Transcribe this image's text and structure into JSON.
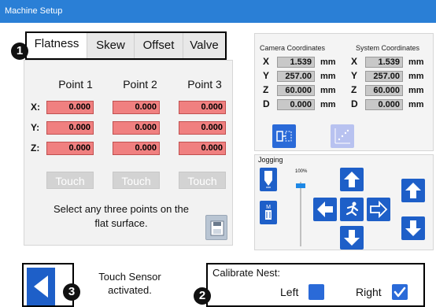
{
  "window": {
    "title": "Machine Setup"
  },
  "tabs": [
    {
      "label": "Flatness",
      "active": true
    },
    {
      "label": "Skew",
      "active": false
    },
    {
      "label": "Offset",
      "active": false
    },
    {
      "label": "Valve",
      "active": false
    }
  ],
  "callouts": {
    "one": "1",
    "two": "2",
    "three": "3"
  },
  "flatness": {
    "columns": [
      "Point 1",
      "Point 2",
      "Point 3"
    ],
    "rows": [
      {
        "label": "X:",
        "values": [
          "0.000",
          "0.000",
          "0.000"
        ]
      },
      {
        "label": "Y:",
        "values": [
          "0.000",
          "0.000",
          "0.000"
        ]
      },
      {
        "label": "Z:",
        "values": [
          "0.000",
          "0.000",
          "0.000"
        ]
      }
    ],
    "touch_label": "Touch",
    "instruction": "Select any three points on the flat surface."
  },
  "coordinates": {
    "camera_title": "Camera Coordinates",
    "system_title": "System Coordinates",
    "unit": "mm",
    "axes": [
      {
        "label": "X",
        "camera": "1.539",
        "system": "1.539"
      },
      {
        "label": "Y",
        "camera": "257.00",
        "system": "257.00"
      },
      {
        "label": "Z",
        "camera": "60.000",
        "system": "60.000"
      },
      {
        "label": "D",
        "camera": "0.000",
        "system": "0.000"
      }
    ]
  },
  "jogging": {
    "title": "Jogging",
    "speed_label": "100%",
    "speed_level": 1.0
  },
  "status": {
    "sensor_message": "Touch Sensor activated."
  },
  "calibrate_nest": {
    "title": "Calibrate Nest:",
    "left_label": "Left",
    "left_checked": false,
    "right_label": "Right",
    "right_checked": true
  },
  "colors": {
    "accent": "#1e5fc8",
    "titlebar": "#2a7fd6",
    "field_alert": "#f08080"
  }
}
